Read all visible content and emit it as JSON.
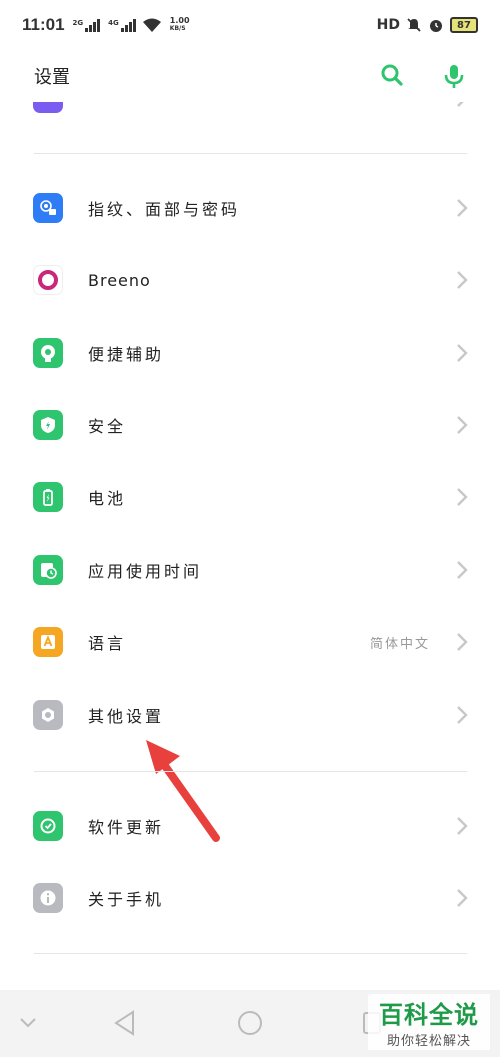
{
  "status_bar": {
    "time": "11:01",
    "sig1": "2G",
    "sig2": "4G",
    "speed_value": "1.00",
    "speed_unit": "KB/S",
    "hd": "HD",
    "battery": "87"
  },
  "header": {
    "title": "设置"
  },
  "items": [
    {
      "label": "指纹、面部与密码",
      "color": "#2f7df6",
      "icon": "face-lock-icon"
    },
    {
      "label": "Breeno",
      "color": "#ffffff",
      "icon": "breeno-icon"
    },
    {
      "label": "便捷辅助",
      "color": "#2fc46e",
      "icon": "assist-icon"
    },
    {
      "label": "安全",
      "color": "#2fc46e",
      "icon": "shield-icon"
    },
    {
      "label": "电池",
      "color": "#2fc46e",
      "icon": "battery-icon"
    },
    {
      "label": "应用使用时间",
      "color": "#2fc46e",
      "icon": "app-time-icon"
    },
    {
      "label": "语言",
      "value": "简体中文",
      "color": "#f5a623",
      "icon": "language-icon"
    },
    {
      "label": "其他设置",
      "color": "#b9b9c0",
      "icon": "gear-icon"
    },
    {
      "label": "软件更新",
      "color": "#2fc46e",
      "icon": "update-icon"
    },
    {
      "label": "关于手机",
      "color": "#b9b9c0",
      "icon": "info-icon"
    }
  ],
  "watermark": {
    "title": "百科全说",
    "subtitle": "助你轻松解决"
  },
  "colors": {
    "accent": "#2fc46e",
    "arrow": "#e8403c"
  }
}
